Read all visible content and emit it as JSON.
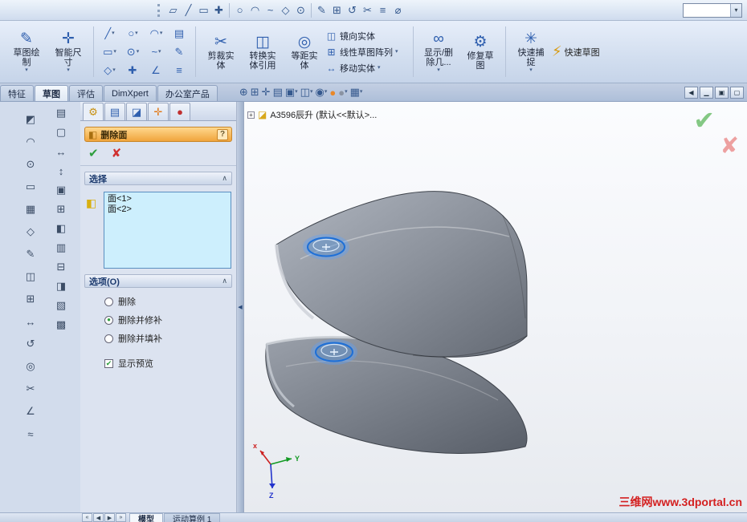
{
  "ui": {
    "dropdown": "▾",
    "chevron_up": "∧",
    "check": "✔",
    "cross": "✘",
    "question": "?",
    "plus": "+",
    "splitter_arrow": "◀",
    "grip": "⋮"
  },
  "colors": {
    "pm_header_from": "#ffd88e",
    "pm_header_to": "#f0a43c",
    "selection_box_fill": "#cdeffd",
    "accept_green": "#2e9e3e",
    "cancel_red": "#d03030",
    "overlay_check_green": "#84c884",
    "overlay_cross_red": "#eda0a0",
    "watermark_red": "#d42020",
    "highlight_blue": "#1e6fd6",
    "model_gray_light": "#b0b6c0",
    "model_gray_dark": "#646a74"
  },
  "top_toolbar": {
    "icons": [
      {
        "name": "parallelogram-tool-icon",
        "glyph": "▱"
      },
      {
        "name": "line-tool-icon",
        "glyph": "╱"
      },
      {
        "name": "rectangle-tool-icon",
        "glyph": "▭"
      },
      {
        "name": "centerline-tool-icon",
        "glyph": "✚"
      },
      {
        "name": "circle-tool-icon",
        "glyph": "○"
      },
      {
        "name": "arc-tool-icon",
        "glyph": "◠"
      },
      {
        "name": "spline-tool-icon",
        "glyph": "~"
      },
      {
        "name": "polygon-tool-icon",
        "glyph": "◇"
      },
      {
        "name": "point-tool-icon",
        "glyph": "⊙"
      },
      {
        "name": "sketch-pencil-icon",
        "glyph": "✎"
      },
      {
        "name": "pattern-tool-icon",
        "glyph": "⊞"
      },
      {
        "name": "rotate-tool-icon",
        "glyph": "↺"
      },
      {
        "name": "trim-tool-icon",
        "glyph": "✂"
      },
      {
        "name": "list-tool-icon",
        "glyph": "≡"
      },
      {
        "name": "diameter-tool-icon",
        "glyph": "⌀"
      }
    ],
    "combo": {
      "value": ""
    }
  },
  "ribbon": {
    "sketch": {
      "l1": "草图绘",
      "l2": "制",
      "icon": "✎",
      "dd": "▾"
    },
    "smart_dim": {
      "l1": "智能尺",
      "l2": "寸",
      "icon": "✛",
      "dd": "▾"
    },
    "entity_grid": [
      {
        "name": "line-entity",
        "glyph": "╱",
        "dd": "▾"
      },
      {
        "name": "circle-entity",
        "glyph": "○",
        "dd": "▾"
      },
      {
        "name": "arc-entity",
        "glyph": "◠",
        "dd": "▾"
      },
      {
        "name": "text-entity",
        "glyph": "▤",
        "dd": ""
      },
      {
        "name": "rectangle-entity",
        "glyph": "▭",
        "dd": "▾"
      },
      {
        "name": "ellipse-entity",
        "glyph": "⊙",
        "dd": "▾"
      },
      {
        "name": "spline-entity",
        "glyph": "~",
        "dd": "▾"
      },
      {
        "name": "pen-entity",
        "glyph": "✎",
        "dd": ""
      },
      {
        "name": "polygon-entity",
        "glyph": "◇",
        "dd": "▾"
      },
      {
        "name": "point-entity",
        "glyph": "✚",
        "dd": ""
      },
      {
        "name": "angle-entity",
        "glyph": "∠",
        "dd": ""
      },
      {
        "name": "more-entity",
        "glyph": "≡",
        "dd": ""
      }
    ],
    "trim": {
      "l1": "剪裁实",
      "l2": "体",
      "icon": "✂",
      "dd": ""
    },
    "convert": {
      "l1": "转换实",
      "l2": "体引用",
      "icon": "◫",
      "dd": ""
    },
    "offset": {
      "l1": "等距实",
      "l2": "体",
      "icon": "◎",
      "dd": ""
    },
    "stack": [
      {
        "label": "镜向实体",
        "icon": "◫",
        "dd": ""
      },
      {
        "label": "线性草图阵列",
        "icon": "⊞",
        "dd": "▾"
      },
      {
        "label": "移动实体",
        "icon": "↔",
        "dd": "▾"
      }
    ],
    "display_delete": {
      "l1": "显示/删",
      "l2": "除几...",
      "icon": "∞",
      "dd": "▾"
    },
    "repair": {
      "l1": "修复草",
      "l2": "图",
      "icon": "⚙",
      "dd": ""
    },
    "quick_snap": {
      "l1": "快速捕",
      "l2": "捉",
      "icon": "✳",
      "dd": "▾"
    },
    "rapid_sketch": {
      "label": "快速草图",
      "icon": "⚡"
    }
  },
  "tab_bar": {
    "tabs": [
      {
        "label": "特征",
        "active": false
      },
      {
        "label": "草图",
        "active": true
      },
      {
        "label": "评估",
        "active": false
      },
      {
        "label": "DimXpert",
        "active": false
      },
      {
        "label": "办公室产品",
        "active": false
      }
    ]
  },
  "headsup": {
    "icons": [
      {
        "name": "zoom-fit-icon",
        "glyph": "⊕",
        "dd": ""
      },
      {
        "name": "zoom-area-icon",
        "glyph": "⊞",
        "dd": ""
      },
      {
        "name": "zoom-select-icon",
        "glyph": "✛",
        "dd": ""
      },
      {
        "name": "notebook-icon",
        "glyph": "▤",
        "dd": ""
      },
      {
        "name": "view-orientation-icon",
        "glyph": "▣",
        "dd": "▾"
      },
      {
        "name": "display-style-icon",
        "glyph": "◫",
        "dd": "▾"
      },
      {
        "name": "hide-show-items-icon",
        "glyph": "◉",
        "dd": "▾"
      },
      {
        "name": "edit-appearance-icon",
        "glyph": "●",
        "dd": ""
      },
      {
        "name": "apply-scene-icon",
        "glyph": "●",
        "dd": "▾"
      },
      {
        "name": "view-settings-icon",
        "glyph": "▦",
        "dd": "▾"
      }
    ]
  },
  "window_buttons": [
    {
      "name": "dock-button",
      "glyph": "◀"
    },
    {
      "name": "minimize-button",
      "glyph": "▁"
    },
    {
      "name": "restore-button",
      "glyph": "▣"
    },
    {
      "name": "float-button",
      "glyph": "▢"
    }
  ],
  "left_toolbar_a": {
    "icons": [
      {
        "name": "select-tool-icon",
        "glyph": "◩"
      },
      {
        "name": "arc-side-icon",
        "glyph": "◠"
      },
      {
        "name": "circle-side-icon",
        "glyph": "⊙"
      },
      {
        "name": "rect-side-icon",
        "glyph": "▭"
      },
      {
        "name": "grid-side-icon",
        "glyph": "▦"
      },
      {
        "name": "polygon-side-icon",
        "glyph": "◇"
      },
      {
        "name": "pencil-side-icon",
        "glyph": "✎"
      },
      {
        "name": "mirror-side-icon",
        "glyph": "◫"
      },
      {
        "name": "pattern-side-icon",
        "glyph": "⊞"
      },
      {
        "name": "move-side-icon",
        "glyph": "↔"
      },
      {
        "name": "rotate-side-icon",
        "glyph": "↺"
      },
      {
        "name": "offset-side-icon",
        "glyph": "◎"
      },
      {
        "name": "trim-side-icon",
        "glyph": "✂"
      },
      {
        "name": "angle-side-icon",
        "glyph": "∠"
      },
      {
        "name": "wave-side-icon",
        "glyph": "≈"
      }
    ]
  },
  "left_toolbar_b": {
    "icons": [
      {
        "name": "ruler-icon",
        "glyph": "▤"
      },
      {
        "name": "note-icon",
        "glyph": "▢"
      },
      {
        "name": "dim-horizontal-icon",
        "glyph": "↔"
      },
      {
        "name": "dim-vertical-icon",
        "glyph": "↕"
      },
      {
        "name": "sheet-icon",
        "glyph": "▣"
      },
      {
        "name": "table-icon",
        "glyph": "⊞"
      },
      {
        "name": "frame-icon",
        "glyph": "◧"
      },
      {
        "name": "doc-icon",
        "glyph": "▥"
      },
      {
        "name": "stack-icon",
        "glyph": "⊟"
      },
      {
        "name": "layer-icon",
        "glyph": "◨"
      },
      {
        "name": "page-icon",
        "glyph": "▧"
      },
      {
        "name": "grid2-icon",
        "glyph": "▩"
      }
    ]
  },
  "property_manager": {
    "tabs": [
      {
        "glyph": "⚙"
      },
      {
        "glyph": "▤"
      },
      {
        "glyph": "◪"
      },
      {
        "glyph": "✛"
      },
      {
        "glyph": "●"
      }
    ],
    "title": "删除面",
    "header_icon": "◧",
    "selection": {
      "header": "选择",
      "icon": "◧",
      "items": [
        "面<1>",
        "面<2>"
      ]
    },
    "options": {
      "header": "选项(O)",
      "radios": [
        {
          "label": "删除",
          "mark": ""
        },
        {
          "label": "删除并修补",
          "mark": "●"
        },
        {
          "label": "删除并填补",
          "mark": ""
        }
      ],
      "checkbox": {
        "label": "显示预览",
        "mark": "✔"
      }
    }
  },
  "viewport": {
    "tree_item": "A3596辰升 (默认<<默认>...",
    "triad": {
      "x_label": "x",
      "y_label": "Y",
      "z_label": "Z"
    },
    "watermark": "三维网www.3dportal.cn"
  },
  "bottom_bar": {
    "nav": [
      {
        "name": "scroll-first",
        "glyph": "«"
      },
      {
        "name": "scroll-prev",
        "glyph": "◀"
      },
      {
        "name": "scroll-next",
        "glyph": "▶"
      },
      {
        "name": "scroll-last",
        "glyph": "»"
      }
    ],
    "tabs": [
      {
        "label": "模型",
        "active": true
      },
      {
        "label": "运动算例 1",
        "active": false
      }
    ]
  }
}
